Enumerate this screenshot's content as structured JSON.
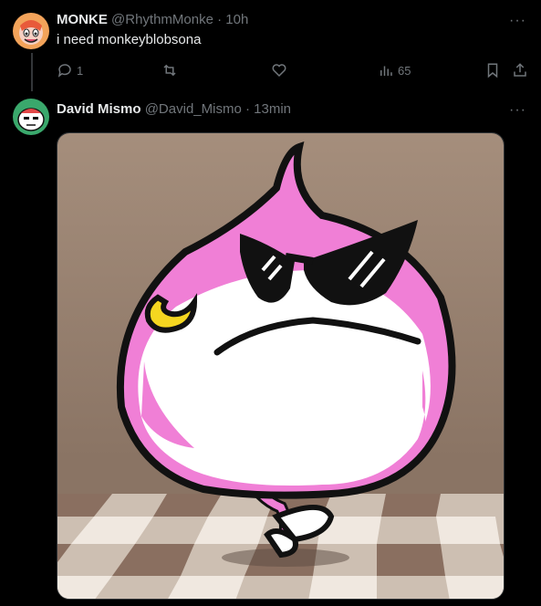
{
  "tweets": [
    {
      "name": "MONKE",
      "handle": "@RhythmMonke",
      "time": "10h",
      "text": "i need monkeyblobsona",
      "actions": {
        "replies": "1",
        "retweets": "",
        "likes": "",
        "views": "65"
      }
    },
    {
      "name": "David Mismo",
      "handle": "@David_Mismo",
      "time": "13min",
      "media_alt": "Pink and white blob character wearing black sunglasses, standing on a checkered floor"
    }
  ],
  "separator": "·",
  "more_label": "···",
  "colors": {
    "background": "#000000",
    "text": "#e7e9ea",
    "muted": "#71767b",
    "pink": "#f07fd6"
  }
}
